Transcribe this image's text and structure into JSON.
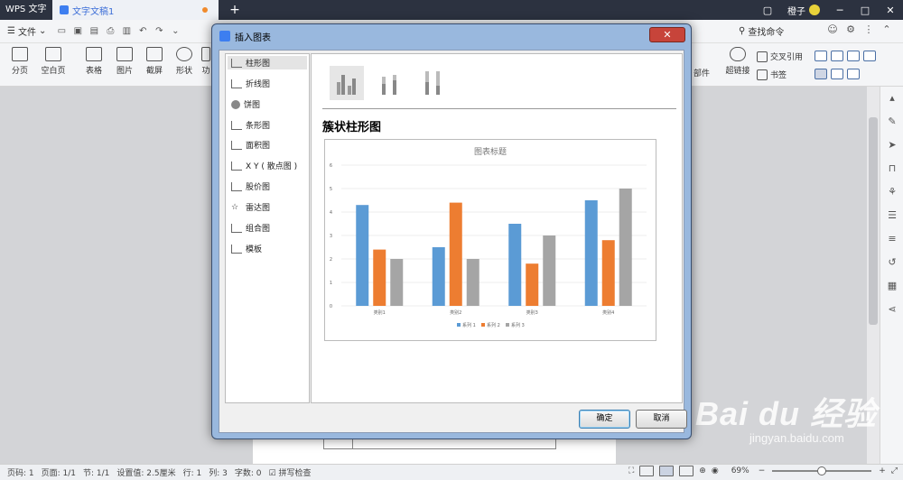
{
  "titlebar": {
    "app_name": "WPS 文字",
    "document_tab": "文字文稿1",
    "new_tab": "+",
    "user_name": "橙子"
  },
  "menubar": {
    "file_menu": "文件",
    "search_command": "查找命令"
  },
  "ribbon": {
    "buttons": [
      "分页",
      "空白页",
      "表格",
      "图片",
      "截屏",
      "形状",
      "功"
    ],
    "right_buttons": [
      "部件",
      "超链接",
      "交叉引用",
      "书签"
    ]
  },
  "dialog": {
    "title": "插入图表",
    "close": "✕",
    "categories": [
      "柱形图",
      "折线图",
      "饼图",
      "条形图",
      "面积图",
      "X Y ( 散点图 )",
      "股价图",
      "雷达图",
      "组合图",
      "模板"
    ],
    "selected_category": "柱形图",
    "preview_title": "簇状柱形图",
    "ok_button": "确定",
    "cancel_button": "取消"
  },
  "chart_data": {
    "type": "bar",
    "title": "图表标题",
    "categories": [
      "类别1",
      "类别2",
      "类别3",
      "类别4"
    ],
    "series": [
      {
        "name": "系列 1",
        "values": [
          4.3,
          2.5,
          3.5,
          4.5
        ],
        "color": "#5b9bd5"
      },
      {
        "name": "系列 2",
        "values": [
          2.4,
          4.4,
          1.8,
          2.8
        ],
        "color": "#ed7d31"
      },
      {
        "name": "系列 3",
        "values": [
          2.0,
          2.0,
          3.0,
          5.0
        ],
        "color": "#a5a5a5"
      }
    ],
    "yticks": [
      "0",
      "1",
      "2",
      "3",
      "4",
      "5",
      "6"
    ],
    "ylim": [
      0,
      6
    ],
    "grid": true,
    "legend": "bottom"
  },
  "statusbar": {
    "page_no": "页码: 1",
    "pages": "页面: 1/1",
    "section": "节: 1/1",
    "setting": "设置值: 2.5厘米",
    "row": "行: 1",
    "col": "列: 3",
    "words": "字数: 0",
    "spell": "拼写检查",
    "zoom": "69%",
    "zoom_minus": "−",
    "zoom_plus": "+"
  },
  "watermark": {
    "main": "Bai du 经验",
    "sub": "jingyan.baidu.com"
  }
}
